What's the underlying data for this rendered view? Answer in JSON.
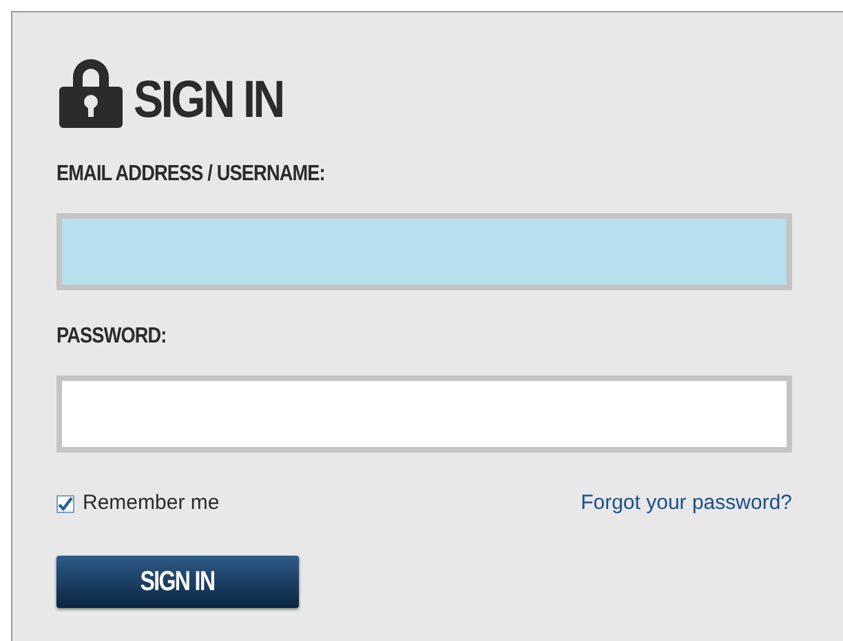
{
  "title": "SIGN IN",
  "fields": [
    {
      "label": "EMAIL ADDRESS / USERNAME:",
      "focused": true
    },
    {
      "label": "PASSWORD:",
      "focused": false
    }
  ],
  "remember": {
    "label": "Remember me",
    "checked": true
  },
  "forgot_link": "Forgot your password?",
  "submit": "SIGN IN"
}
